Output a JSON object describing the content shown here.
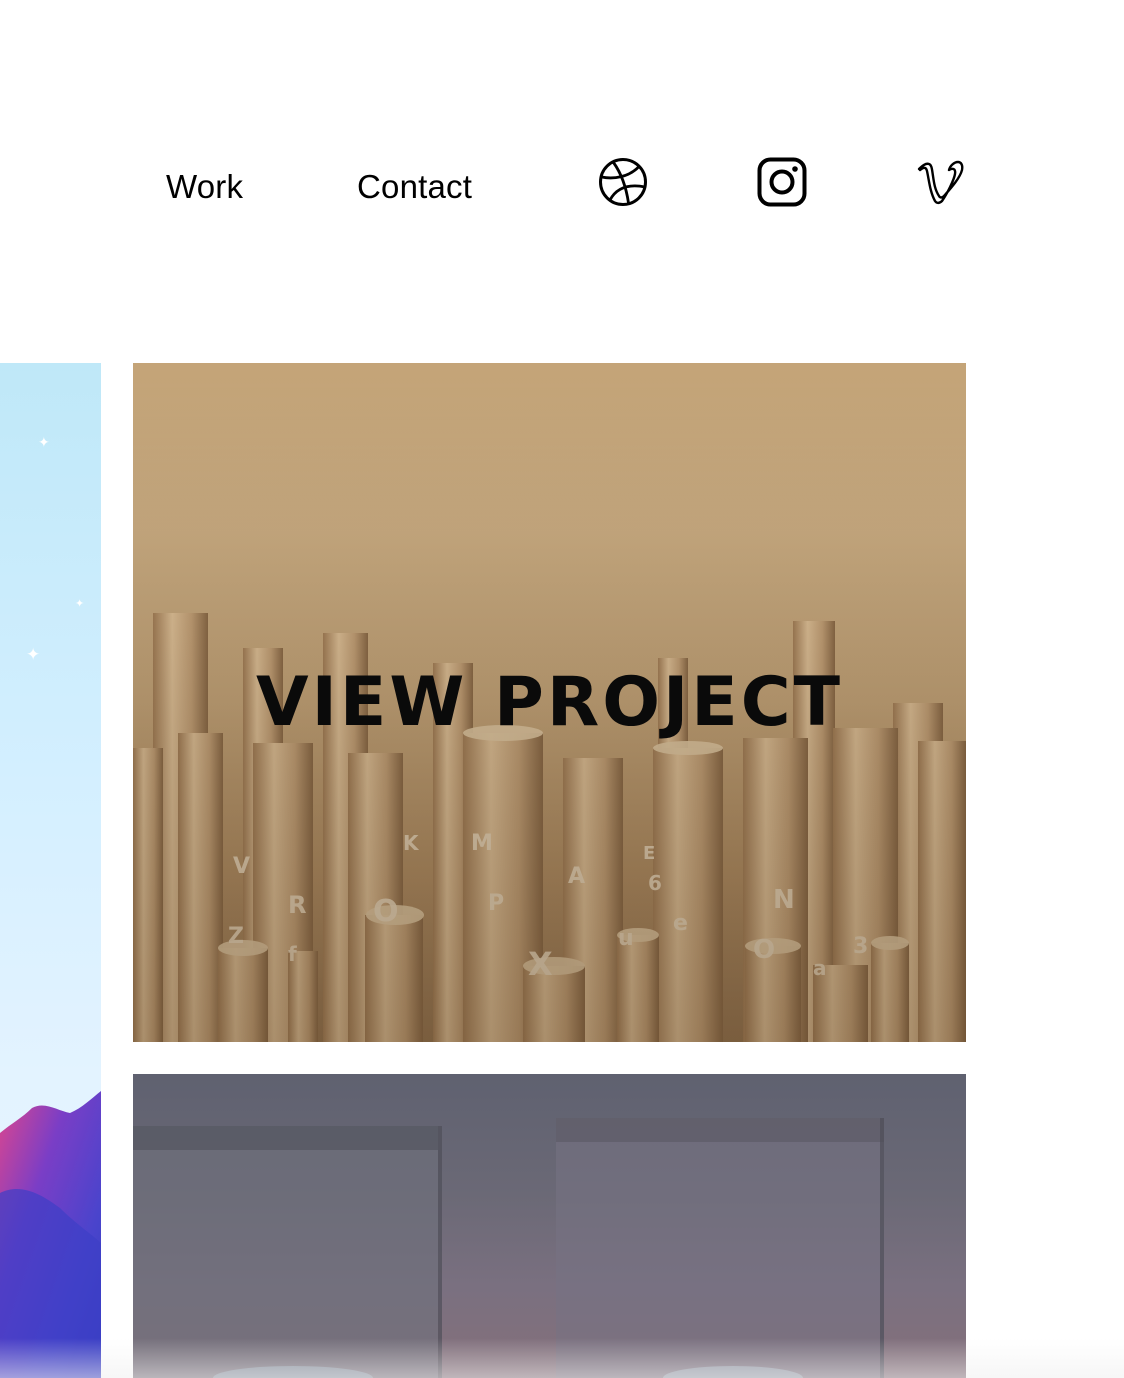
{
  "nav": {
    "work_label": "Work",
    "contact_label": "Contact",
    "social": [
      {
        "name": "dribbble",
        "icon": "dribbble-icon"
      },
      {
        "name": "instagram",
        "icon": "instagram-icon"
      },
      {
        "name": "vimeo",
        "icon": "vimeo-icon"
      }
    ]
  },
  "projects": [
    {
      "overlay_label": "VIEW PROJECT",
      "image": "cylinders-with-letters"
    },
    {
      "overlay_label": "",
      "image": "grey-interior"
    }
  ],
  "colors": {
    "text": "#000000",
    "background": "#ffffff",
    "card1_tone": "#c9a87c",
    "card2_tone": "#6b6976",
    "left_card_sky": "#cfeefc"
  }
}
